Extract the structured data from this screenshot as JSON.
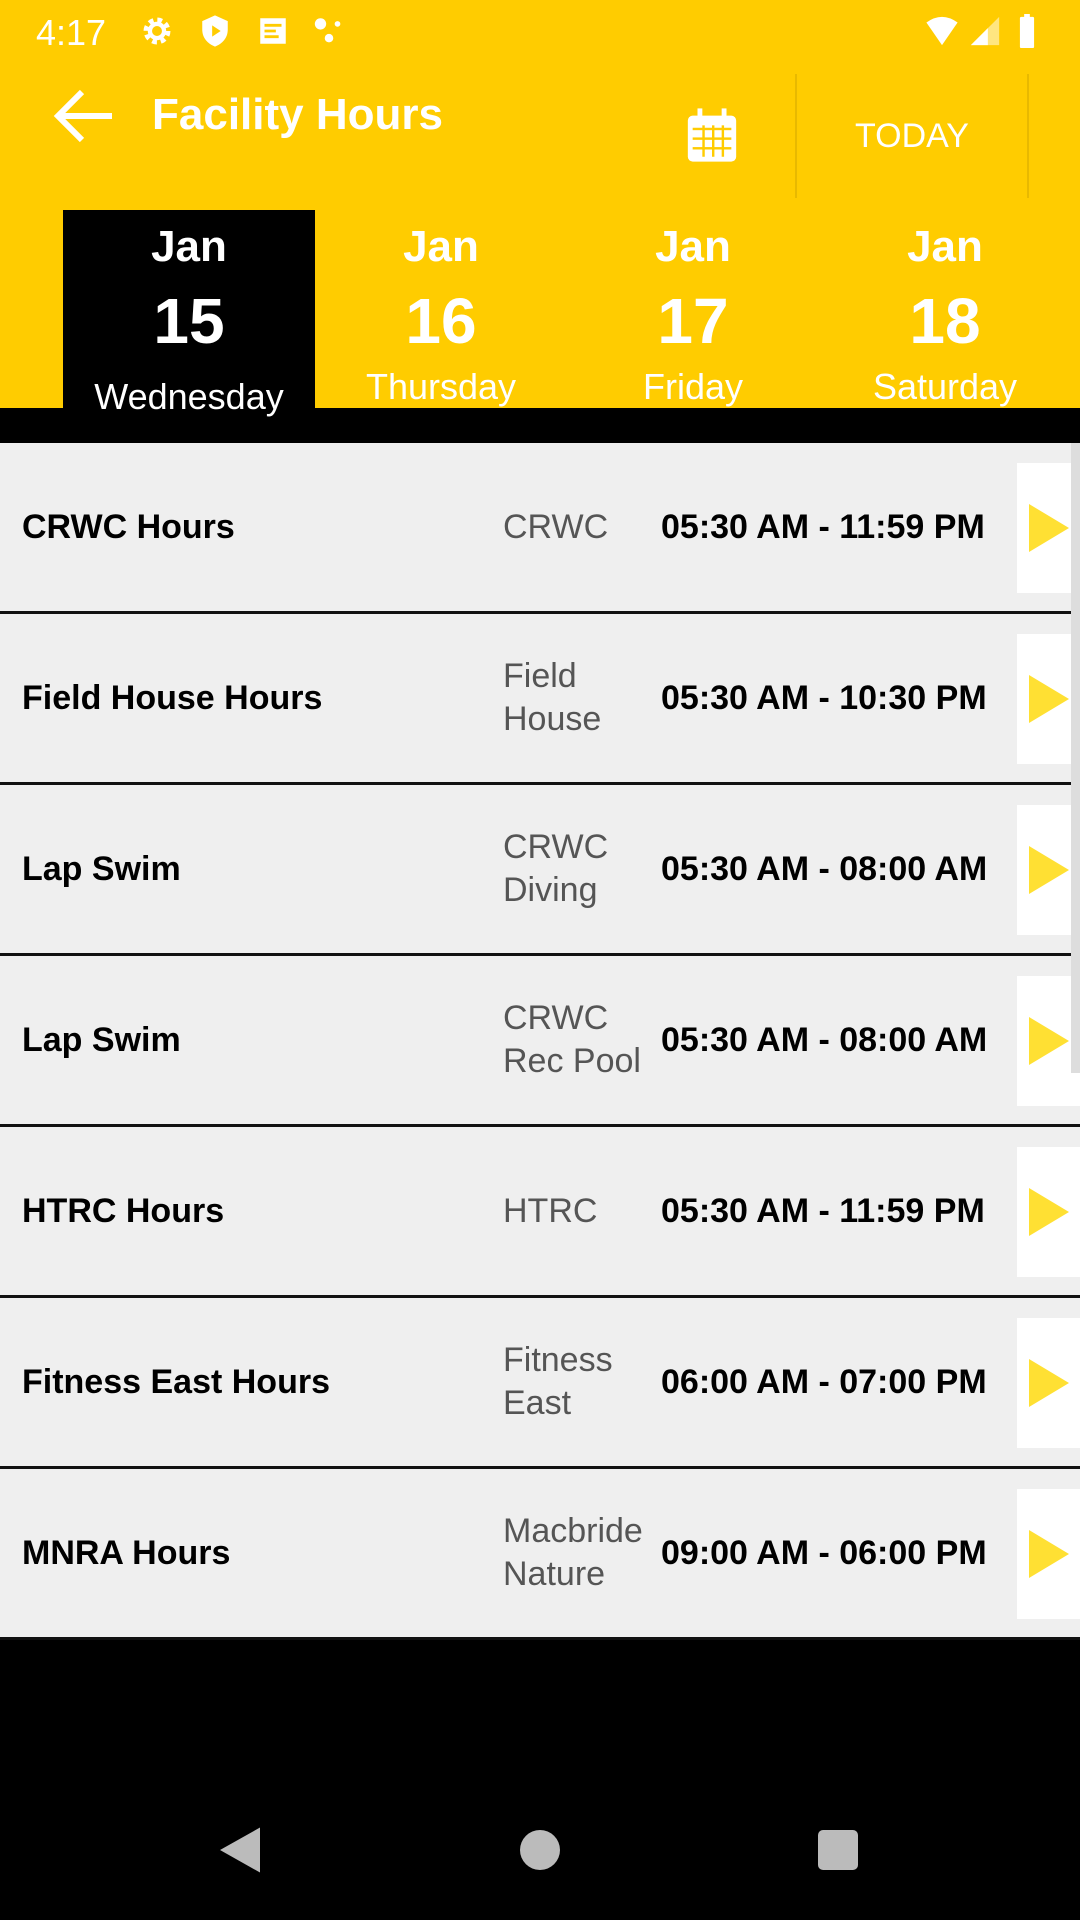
{
  "status_bar": {
    "time": "4:17",
    "icons": [
      "gear-icon",
      "shield-play-icon",
      "inbox-icon",
      "dots-icon",
      "wifi-icon",
      "signal-icon",
      "battery-icon"
    ]
  },
  "toolbar": {
    "title": "Facility Hours",
    "today_label": "TODAY",
    "calendar_icon": "calendar-icon"
  },
  "colors": {
    "accent": "#FFCC00",
    "selected_tab": "#000000",
    "arrow": "#FFE033"
  },
  "date_tabs": [
    {
      "month": "Jan",
      "day": "15",
      "weekday": "Wednesday",
      "selected": true
    },
    {
      "month": "Jan",
      "day": "16",
      "weekday": "Thursday"
    },
    {
      "month": "Jan",
      "day": "17",
      "weekday": "Friday"
    },
    {
      "month": "Jan",
      "day": "18",
      "weekday": "Saturday"
    }
  ],
  "rows": [
    {
      "name": "CRWC Hours",
      "location": "CRWC",
      "hours": "05:30 AM - 11:59 PM"
    },
    {
      "name": "Field House Hours",
      "location": "Field House",
      "hours": "05:30 AM - 10:30 PM"
    },
    {
      "name": "Lap Swim",
      "location": "CRWC Diving",
      "hours": "05:30 AM - 08:00 AM"
    },
    {
      "name": "Lap Swim",
      "location": "CRWC Rec Pool",
      "hours": "05:30 AM - 08:00 AM"
    },
    {
      "name": "HTRC Hours",
      "location": "HTRC",
      "hours": "05:30 AM - 11:59 PM"
    },
    {
      "name": "Fitness East Hours",
      "location": "Fitness East",
      "hours": "06:00 AM - 07:00 PM"
    },
    {
      "name": "MNRA Hours",
      "location": "Macbride Nature",
      "hours": "09:00 AM - 06:00 PM"
    }
  ]
}
